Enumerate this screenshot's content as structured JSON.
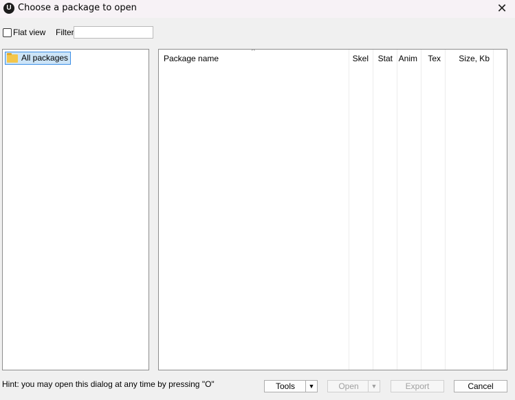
{
  "window": {
    "title": "Choose a package to open",
    "close_symbol": "✕",
    "app_icon_text": "U"
  },
  "toolbar": {
    "flat_view_label": "Flat view",
    "flat_view_checked": false,
    "filter_label": "Filter:",
    "filter_value": ""
  },
  "tree": {
    "root_label": "All packages"
  },
  "list": {
    "sort_indicator": "^",
    "columns": [
      "Package name",
      "Skel",
      "Stat",
      "Anim",
      "Tex",
      "Size, Kb"
    ],
    "rows": []
  },
  "footer": {
    "hint": "Hint: you may open this dialog at any time by pressing \"O\"",
    "tools_label": "Tools",
    "open_label": "Open",
    "export_label": "Export",
    "cancel_label": "Cancel",
    "dropdown_symbol": "▼"
  }
}
